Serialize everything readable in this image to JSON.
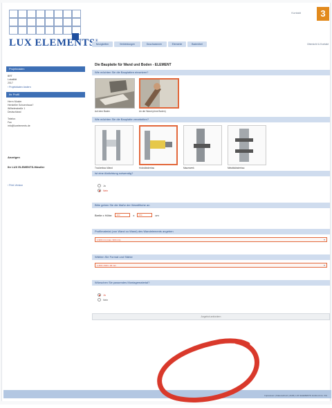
{
  "badge": "3",
  "top_link": "Kontakt",
  "logo": {
    "text": "LUX ELEMENTS"
  },
  "nav": {
    "tabs": [
      "Neuigkeiten",
      "Verkleidungen",
      "Duschwannen",
      "Elemente",
      "Badmöbel"
    ],
    "right": "Übersicht & Kontakt"
  },
  "sidebar": {
    "project_head": "Projektdaten",
    "project_lines": [
      "BRT",
      "Lokalität",
      "2017"
    ],
    "project_link": "› Projektdaten ändern",
    "profile_head": "Ihr Profil",
    "profile_lines": [
      "Herrn Muster",
      "Hersteller Schoenhaus?",
      "Wilhelmstraße 1",
      "Deutschland",
      "",
      "Telefon",
      "Fax",
      "info@luxelements.de"
    ],
    "other_head": "Anzeigen",
    "other_line": "Ihr LUX ELEMENTS-Händler",
    "print_link": "› Print-Version"
  },
  "main": {
    "title": "Die Bauplatte für Wand und Boden - ELEMENT",
    "q1": "Wie möchten Sie die Bauplatten einsetzen?",
    "photos": [
      "Auf dem Boden",
      "An der Wand (ohne Boden)"
    ],
    "q2": "Wie möchten Sie die Bauplatte verarbeiten?",
    "products": [
      "Trockenbau Wand",
      "Holzständerbau",
      "Mauerwerk",
      "Metallständerbau"
    ],
    "q3": "Ist eine Abdichtung notwendig?",
    "q3_options": [
      "Ja",
      "Nein"
    ],
    "q4": "Bitte geben Sie die Maße der Wandfläche an",
    "dim_label": "Breite x Höhe:",
    "dim_width": "300",
    "dim_height": "250",
    "dim_unit": "cm",
    "q5": "Profilmaterial (von Wand zu Wand) des Wandelements angeben",
    "select1": "1.900 mm (max. 300 mm)",
    "q6": "Wählen Sie Format und Stärke",
    "select2": "1.250 x 600 x 30 mm",
    "q7": "Wünschen Sie passendes Montagematerial?",
    "q7_options": [
      "Ja",
      "Nein"
    ],
    "submit": "Angebot anfordern"
  },
  "footer": {
    "text": "Impressum | Datenschutz | AGB | LUX ELEMENTS GmbH & Co. KG"
  },
  "colors": {
    "brand": "#1f4f9f",
    "section": "#cfdcee",
    "accent": "#e2673a",
    "circle": "#d9392b"
  }
}
